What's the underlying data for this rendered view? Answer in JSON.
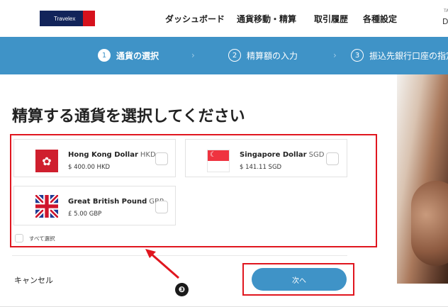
{
  "header": {
    "logo_text": "Travelex",
    "nav": [
      "ダッシュボード",
      "通貨移動・精算",
      "取引履歴",
      "各種設定"
    ],
    "edge_small": "TA",
    "edge_big": "D"
  },
  "steps": [
    {
      "num": "1",
      "label": "通貨の選択",
      "state": "active"
    },
    {
      "num": "2",
      "label": "精算額の入力",
      "state": "inactive"
    },
    {
      "num": "3",
      "label": "振込先銀行口座の指定",
      "state": "inactive"
    }
  ],
  "main": {
    "title": "精算する通貨を選択してください",
    "currencies": [
      {
        "name": "Hong Kong Dollar",
        "code": "HKD",
        "amount": "$ 400.00 HKD",
        "flag_icon": "hk-flag-icon"
      },
      {
        "name": "Singapore Dollar",
        "code": "SGD",
        "amount": "$ 141.11 SGD",
        "flag_icon": "sg-flag-icon"
      },
      {
        "name": "Great British Pound",
        "code": "GBP",
        "amount": "£ 5.00 GBP",
        "flag_icon": "gb-flag-icon"
      }
    ],
    "select_all": "すべて選択",
    "cancel": "キャンセル",
    "next": "次へ"
  },
  "annotation": {
    "marker": "❸",
    "highlight_color": "#e0161f"
  },
  "colors": {
    "accent": "#3f93c7",
    "brand_navy": "#12245a",
    "brand_red": "#d6121d"
  }
}
